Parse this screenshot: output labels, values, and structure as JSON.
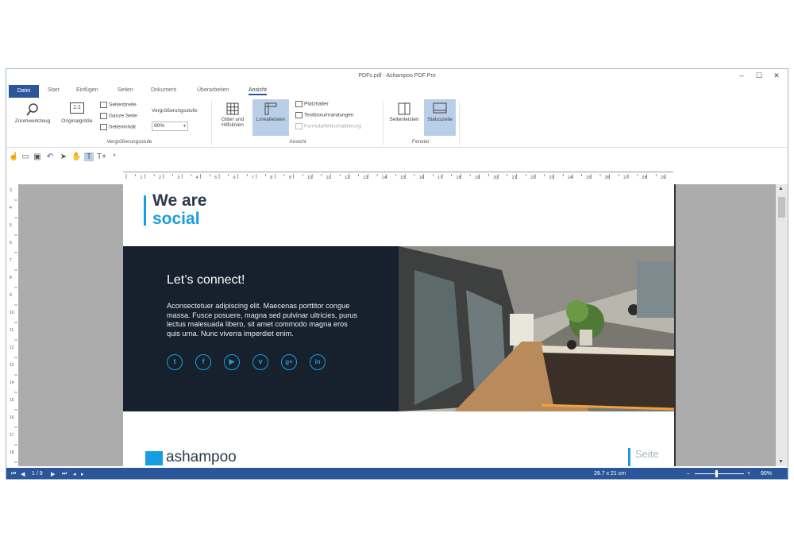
{
  "window": {
    "title": "PDFs.pdf - Ashampoo PDF Pro",
    "minimize": "–",
    "maximize": "☐",
    "close": "✕"
  },
  "tabs": [
    "Datei",
    "Start",
    "Einfügen",
    "Seiten",
    "Dokument",
    "Überarbeiten",
    "Ansicht"
  ],
  "help_label": "?",
  "ribbon": {
    "zoomwerkzeug": "Zoomwerkzeug",
    "originalgroesse": "Originalgröße",
    "originalgroesse_icon": "1:1",
    "seitenbreite": "Seitenbreite",
    "ganze_seite": "Ganze Seite",
    "seiteninhalt": "Seiteninhalt",
    "vergroesserungsstufe_label": "Vergrößerungsstufe:",
    "zoom_value": "90%",
    "group_zoom": "Vergrößerungsstufe",
    "gitter_line1": "Gitter und",
    "gitter_line2": "Hilfslinien",
    "linealleisten": "Linealleisten",
    "platzhalter": "Platzhalter",
    "textboxumrandungen": "Textboxumrandungen",
    "formularfeld": "Formularfeldschattierung",
    "group_ansicht": "Ansicht",
    "seitenleisten": "Seitenleisten",
    "statuszeile": "Statuszeile",
    "group_fenster": "Fenster"
  },
  "ruler": {
    "h_labels": [
      "1",
      "2",
      "3",
      "4",
      "5",
      "6",
      "7",
      "8",
      "9",
      "10",
      "11",
      "12",
      "13",
      "14",
      "15",
      "16",
      "17",
      "18",
      "19",
      "20",
      "21",
      "22",
      "23",
      "24",
      "25",
      "26",
      "27",
      "28",
      "29"
    ],
    "v_labels": [
      "3",
      "4",
      "5",
      "6",
      "7",
      "8",
      "9",
      "10",
      "11",
      "12",
      "13",
      "14",
      "15",
      "16",
      "17",
      "18"
    ]
  },
  "document": {
    "headline_line1": "We are",
    "headline_line2": "social",
    "connect_title": "Let’s connect!",
    "connect_body": "Aconsectetuer adipiscing elit. Maecenas porttitor congue massa. Fusce posuere, magna sed pulvinar ultricies, purus lectus malesuada libero, sit amet commodo magna eros quis urna. Nunc viverra imperdiet enim.",
    "social_icons": [
      "twitter-icon",
      "facebook-icon",
      "youtube-icon",
      "vimeo-icon",
      "googleplus-icon",
      "linkedin-icon"
    ],
    "social_glyphs": [
      "t",
      "f",
      "▶",
      "v",
      "g+",
      "in"
    ],
    "logo_text": "ashampoo",
    "seite_label": "Seite"
  },
  "status": {
    "page": "1 / 9",
    "size": "29.7 x 21 cm",
    "zoom": "90%",
    "zoom_minus": "–",
    "zoom_plus": "+"
  },
  "colors": {
    "accent": "#1a9de0",
    "ribbon_blue": "#2b579a",
    "dark_panel": "#16212d"
  }
}
